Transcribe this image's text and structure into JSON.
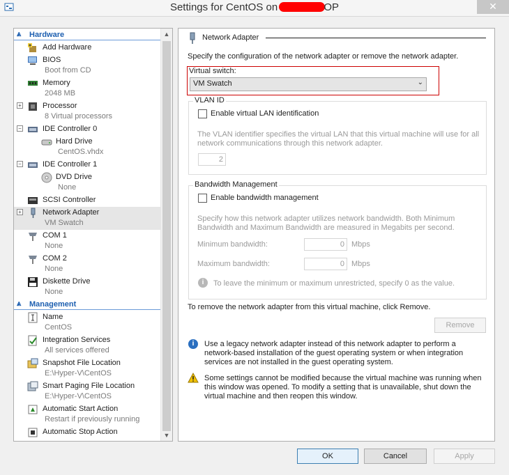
{
  "window": {
    "title_before": "Settings for CentOS on",
    "title_after": "OP",
    "close": "✕"
  },
  "tree": {
    "hardware_label": "Hardware",
    "management_label": "Management",
    "hardware": [
      {
        "name": "Add Hardware"
      },
      {
        "name": "BIOS",
        "sub": "Boot from CD"
      },
      {
        "name": "Memory",
        "sub": "2048 MB"
      },
      {
        "name": "Processor",
        "sub": "8 Virtual processors"
      },
      {
        "name": "IDE Controller 0"
      },
      {
        "name": "Hard Drive",
        "sub": "CentOS.vhdx"
      },
      {
        "name": "IDE Controller 1"
      },
      {
        "name": "DVD Drive",
        "sub": "None"
      },
      {
        "name": "SCSI Controller"
      },
      {
        "name": "Network Adapter",
        "sub": "VM Swatch"
      },
      {
        "name": "COM 1",
        "sub": "None"
      },
      {
        "name": "COM 2",
        "sub": "None"
      },
      {
        "name": "Diskette Drive",
        "sub": "None"
      }
    ],
    "management": [
      {
        "name": "Name",
        "sub": "CentOS"
      },
      {
        "name": "Integration Services",
        "sub": "All services offered"
      },
      {
        "name": "Snapshot File Location",
        "sub": "E:\\Hyper-V\\CentOS"
      },
      {
        "name": "Smart Paging File Location",
        "sub": "E:\\Hyper-V\\CentOS"
      },
      {
        "name": "Automatic Start Action",
        "sub": "Restart if previously running"
      },
      {
        "name": "Automatic Stop Action"
      }
    ]
  },
  "panel": {
    "heading": "Network Adapter",
    "description": "Specify the configuration of the network adapter or remove the network adapter.",
    "switch_label": "Virtual switch:",
    "switch_value": "VM Swatch",
    "vlan_group": "VLAN ID",
    "vlan_checkbox": "Enable virtual LAN identification",
    "vlan_desc_1": "The VLAN identifier specifies the virtual LAN that this virtual machine will use for all",
    "vlan_desc_2": "network communications through this network adapter.",
    "vlan_value": "2",
    "bw_group": "Bandwidth Management",
    "bw_checkbox": "Enable bandwidth management",
    "bw_desc_1": "Specify how this network adapter utilizes network bandwidth. Both Minimum",
    "bw_desc_2": "Bandwidth and Maximum Bandwidth are measured in Megabits per second.",
    "min_label": "Minimum bandwidth:",
    "min_value": "0",
    "max_label": "Maximum bandwidth:",
    "max_value": "0",
    "unit": "Mbps",
    "bw_hint": "To leave the minimum or maximum unrestricted, specify 0 as the value.",
    "remove_text": "To remove the network adapter from this virtual machine, click Remove.",
    "remove_button": "Remove",
    "legacy_1": "Use a legacy network adapter instead of this network adapter to perform a",
    "legacy_2": "network-based installation of the guest operating system or when integration",
    "legacy_3": "services are not installed in the guest operating system.",
    "warn_1": "Some settings cannot be modified because the virtual machine was running when",
    "warn_2": "this window was opened. To modify a setting that is unavailable, shut down the",
    "warn_3": "virtual machine and then reopen this window."
  },
  "buttons": {
    "ok": "OK",
    "cancel": "Cancel",
    "apply": "Apply"
  },
  "colors": {
    "accent": "#1d5fb0",
    "highlight_box": "#cc0000"
  }
}
